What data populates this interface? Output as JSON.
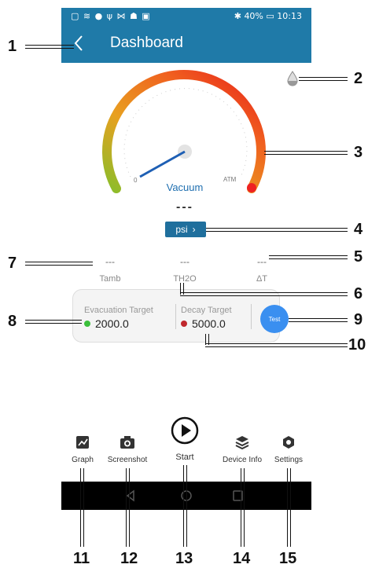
{
  "status_bar": {
    "left_icons": "▢ ≋ ● ψ ⋈ ☗ ▣",
    "battery": "40%",
    "time": "10:13"
  },
  "app_bar": {
    "title": "Dashboard"
  },
  "gauge": {
    "min_label": "0",
    "max_label": "ATM",
    "mode_label": "Vacuum",
    "value": "---",
    "unit": "psi"
  },
  "readings": [
    {
      "value": "---",
      "label": "Tamb"
    },
    {
      "value": "---",
      "label": "TH2O"
    },
    {
      "value": "---",
      "label": "ΔT"
    }
  ],
  "targets": {
    "evacuation": {
      "label": "Evacuation Target",
      "value": "2000.0",
      "color": "#3bbf3b"
    },
    "decay": {
      "label": "Decay Target",
      "value": "5000.0",
      "color": "#c0282d"
    },
    "test_label": "Test"
  },
  "bottom_nav": [
    {
      "label": "Graph",
      "icon": "graph-icon"
    },
    {
      "label": "Screenshot",
      "icon": "camera-icon"
    },
    {
      "label": "Start",
      "icon": "play-icon"
    },
    {
      "label": "Device Info",
      "icon": "layers-icon"
    },
    {
      "label": "Settings",
      "icon": "settings-icon"
    }
  ],
  "callouts": [
    "1",
    "2",
    "3",
    "4",
    "5",
    "6",
    "7",
    "8",
    "9",
    "10",
    "11",
    "12",
    "13",
    "14",
    "15"
  ],
  "colors": {
    "app_bar": "#1f7aa8",
    "test_button": "#3a8ff0",
    "unit_button": "#1f6f9d"
  }
}
